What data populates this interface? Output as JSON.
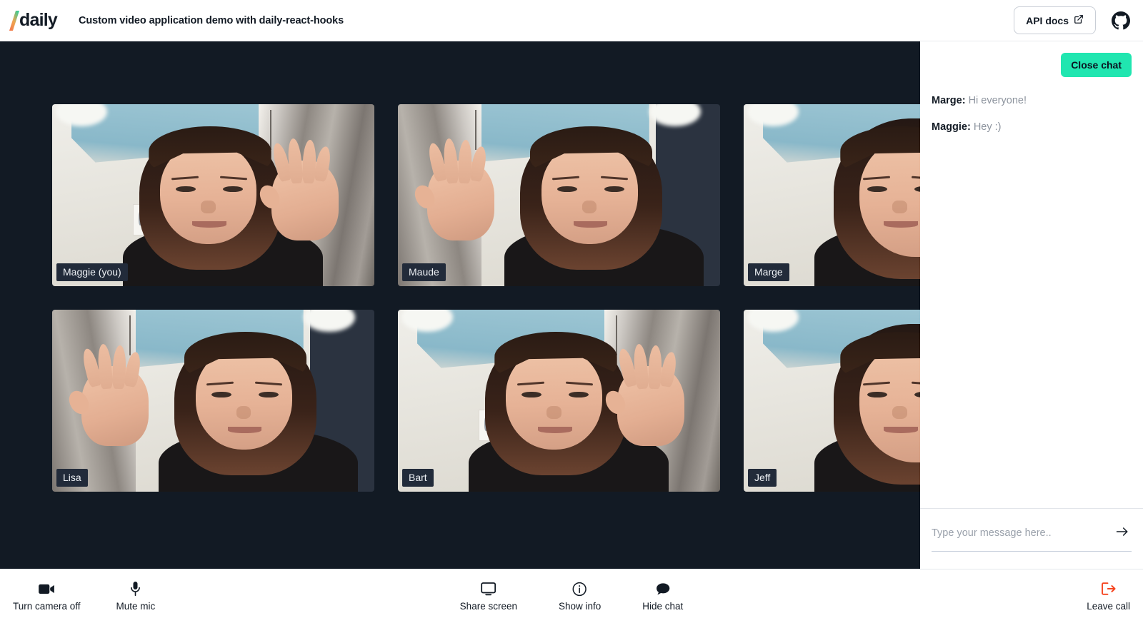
{
  "header": {
    "brand": "daily",
    "brand_slash_icon": "slash-gradient-icon",
    "title": "Custom video application demo with daily-react-hooks",
    "api_docs_label": "API docs",
    "api_docs_icon": "external-link-icon",
    "github_icon": "github-icon"
  },
  "video": {
    "background_color": "#121a24",
    "tiles": [
      {
        "name": "Maggie (you)",
        "variant": "a"
      },
      {
        "name": "Maude",
        "variant": "b"
      },
      {
        "name": "Marge",
        "variant": "c"
      },
      {
        "name": "Lisa",
        "variant": "b"
      },
      {
        "name": "Bart",
        "variant": "a"
      },
      {
        "name": "Jeff",
        "variant": "c"
      }
    ]
  },
  "chat": {
    "close_label": "Close chat",
    "close_button_color": "#20e6b0",
    "messages": [
      {
        "sender": "Marge:",
        "text": "Hi everyone!"
      },
      {
        "sender": "Maggie:",
        "text": "Hey :)"
      }
    ],
    "input_placeholder": "Type your message here..",
    "input_value": "",
    "send_icon": "arrow-right-icon"
  },
  "tray": {
    "camera": {
      "label": "Turn camera off",
      "icon": "video-camera-icon"
    },
    "mic": {
      "label": "Mute mic",
      "icon": "microphone-icon"
    },
    "screen": {
      "label": "Share screen",
      "icon": "monitor-icon"
    },
    "info": {
      "label": "Show info",
      "icon": "info-circle-icon"
    },
    "chat": {
      "label": "Hide chat",
      "icon": "chat-bubble-icon"
    },
    "leave": {
      "label": "Leave call",
      "icon": "logout-icon",
      "color": "#f5441f"
    }
  }
}
